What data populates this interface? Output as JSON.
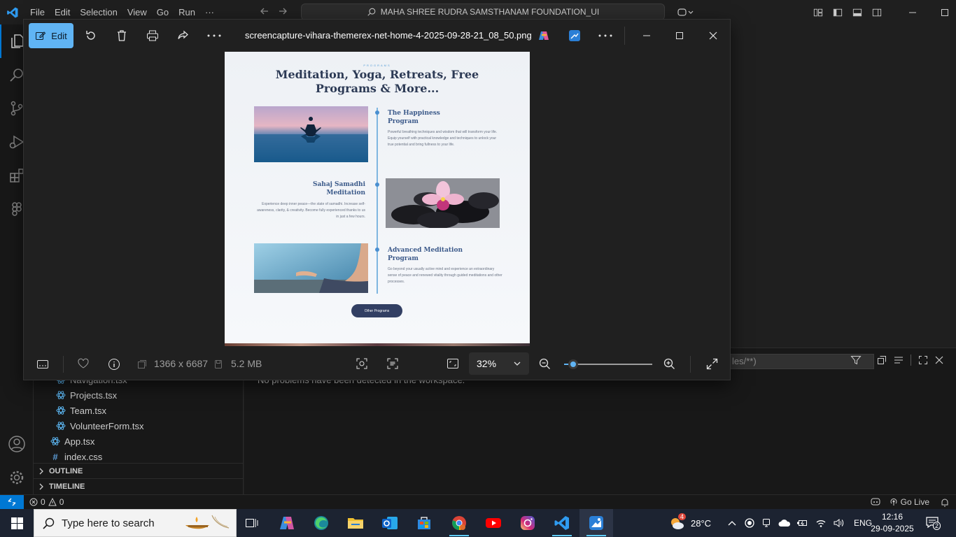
{
  "vscode": {
    "menu": [
      "File",
      "Edit",
      "Selection",
      "View",
      "Go",
      "Run"
    ],
    "menu_more": "···",
    "command_center": "MAHA SHREE RUDRA SAMSTHANAM FOUNDATION_UI",
    "explorer_files": [
      {
        "name": "Navigation.tsx",
        "kind": "react"
      },
      {
        "name": "Projects.tsx",
        "kind": "react"
      },
      {
        "name": "Team.tsx",
        "kind": "react"
      },
      {
        "name": "VolunteerForm.tsx",
        "kind": "react"
      },
      {
        "name": "App.tsx",
        "kind": "react"
      },
      {
        "name": "index.css",
        "kind": "css"
      }
    ],
    "outline_label": "OUTLINE",
    "timeline_label": "TIMELINE",
    "panel": {
      "filter_text": "les/**)",
      "message": "No problems have been detected in the workspace."
    },
    "status": {
      "errors": "0",
      "warnings": "0",
      "go_live": "Go Live"
    }
  },
  "photos": {
    "edit_label": "Edit",
    "filename": "screencapture-vihara-themerex-net-home-4-2025-09-28-21_08_50.png",
    "dimensions": "1366 x 6687",
    "file_size": "5.2 MB",
    "zoom": "32%",
    "zoom_level": 0.1,
    "image": {
      "kicker": "PROGRAMS",
      "title": "Meditation, Yoga, Retreats, Free Programs & More...",
      "programs": [
        {
          "title": "The Happiness Program",
          "desc": "Powerful breathing techniques and wisdom that will transform your life. Equip yourself with practical knowledge and techniques to unlock your true potential and bring fullness to your life."
        },
        {
          "title": "Sahaj Samadhi Meditation",
          "desc": "Experience deep inner peace—the state of samadhi. Increase self-awareness, clarity, & creativity. Become fully experienced thanks to us in just a few hours."
        },
        {
          "title": "Advanced Meditation Program",
          "desc": "Go beyond your usually active mind and experience an extraordinary sense of peace and renewed vitality through guided meditations and other processes."
        }
      ],
      "button": "Other Programs"
    }
  },
  "taskbar": {
    "search_placeholder": "Type here to search",
    "weather": "28°C",
    "weather_badge": "4",
    "language": "ENG",
    "time": "12:16",
    "date": "29-09-2025",
    "notifications": "2"
  },
  "colors": {
    "accent": "#60b4f4",
    "vscode_blue": "#0078d4",
    "button_navy": "#323f63"
  }
}
